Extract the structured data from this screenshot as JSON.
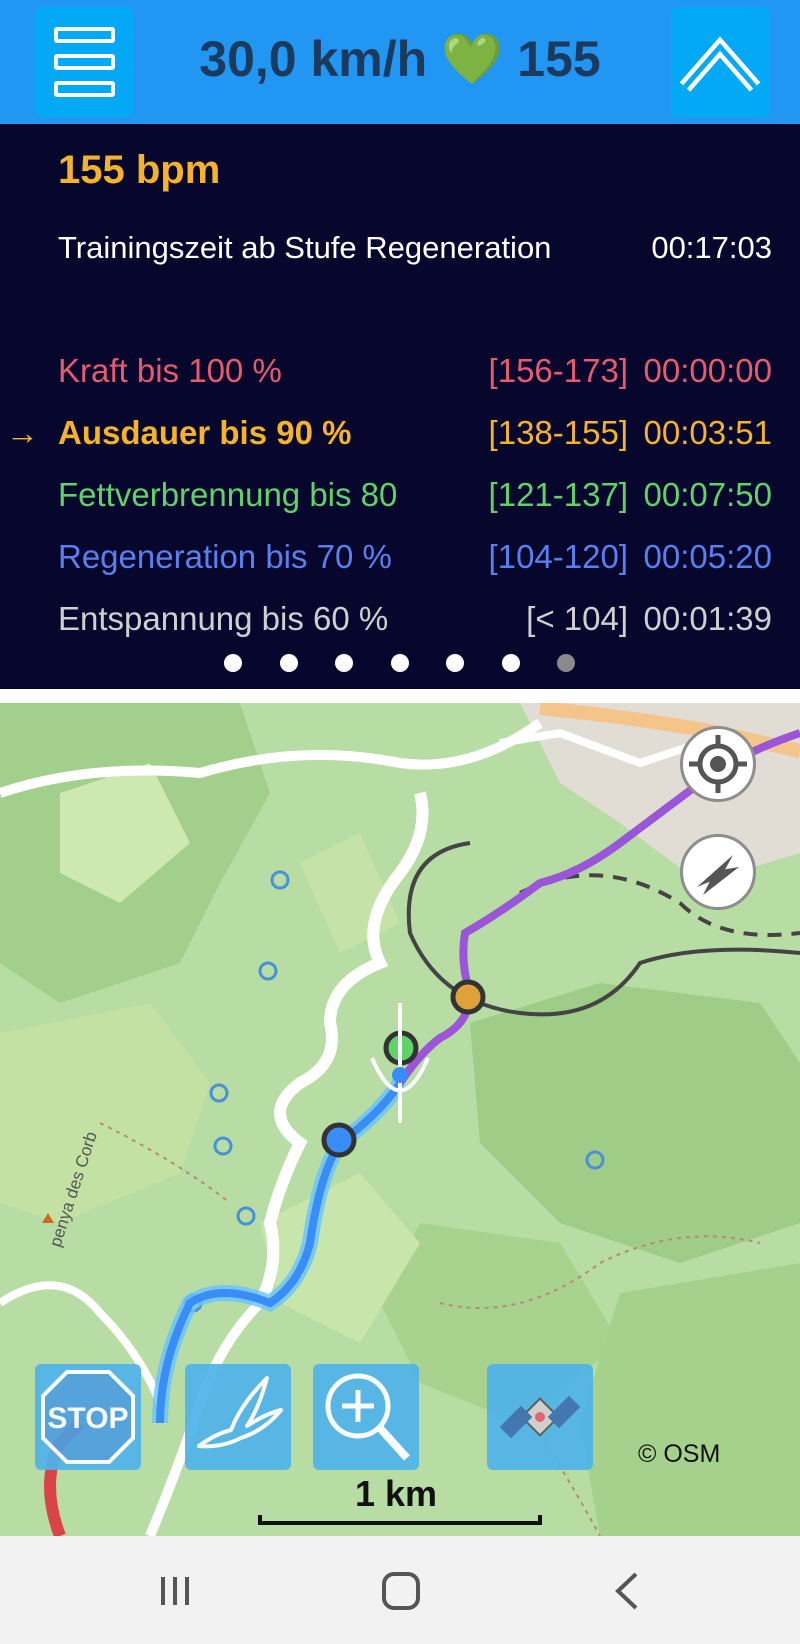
{
  "topbar": {
    "speed": "30,0 km/h",
    "heart_symbol": "💚",
    "heart_rate": "155"
  },
  "panel": {
    "bpm": "155 bpm",
    "training_label": "Trainingszeit ab Stufe Regeneration",
    "training_time": "00:17:03",
    "current_zone_marker": "→",
    "zones": [
      {
        "name": "Kraft bis 100 %",
        "range": "[156-173]",
        "time": "00:00:00",
        "color": "#e85a6e",
        "bold": false
      },
      {
        "name": "Ausdauer bis 90 %",
        "range": "[138-155]",
        "time": "00:03:51",
        "color": "#f5b32a",
        "bold": true
      },
      {
        "name": "Fettverbrennung bis 80",
        "range": "[121-137]",
        "time": "00:07:50",
        "color": "#5fd36a",
        "bold": false
      },
      {
        "name": "Regeneration bis 70 %",
        "range": "[104-120]",
        "time": "00:05:20",
        "color": "#5a7ff0",
        "bold": false
      },
      {
        "name": "Entspannung bis 60 %",
        "range": "[< 104]",
        "time": "00:01:39",
        "color": "#d0d0d0",
        "bold": false
      }
    ],
    "page_count": 7,
    "active_page": 7
  },
  "map": {
    "attribution": "© OSM",
    "scale_label": "1 km",
    "place_label": "penya des Corb",
    "stop_label": "STOP",
    "route_colors": {
      "start": "#3a8df7",
      "end": "#9a55d8"
    }
  },
  "icons": {
    "menu": "hamburger-menu-icon",
    "up": "chevron-up-icon",
    "locate": "crosshair-icon",
    "compass": "compass-icon",
    "stop": "stop-sign-icon",
    "bird": "bird-icon",
    "zoom": "zoom-in-icon",
    "satellite": "satellite-icon"
  },
  "colors": {
    "topbar": "#2196f3",
    "button": "#03a9f4",
    "panel": "#07062d"
  }
}
